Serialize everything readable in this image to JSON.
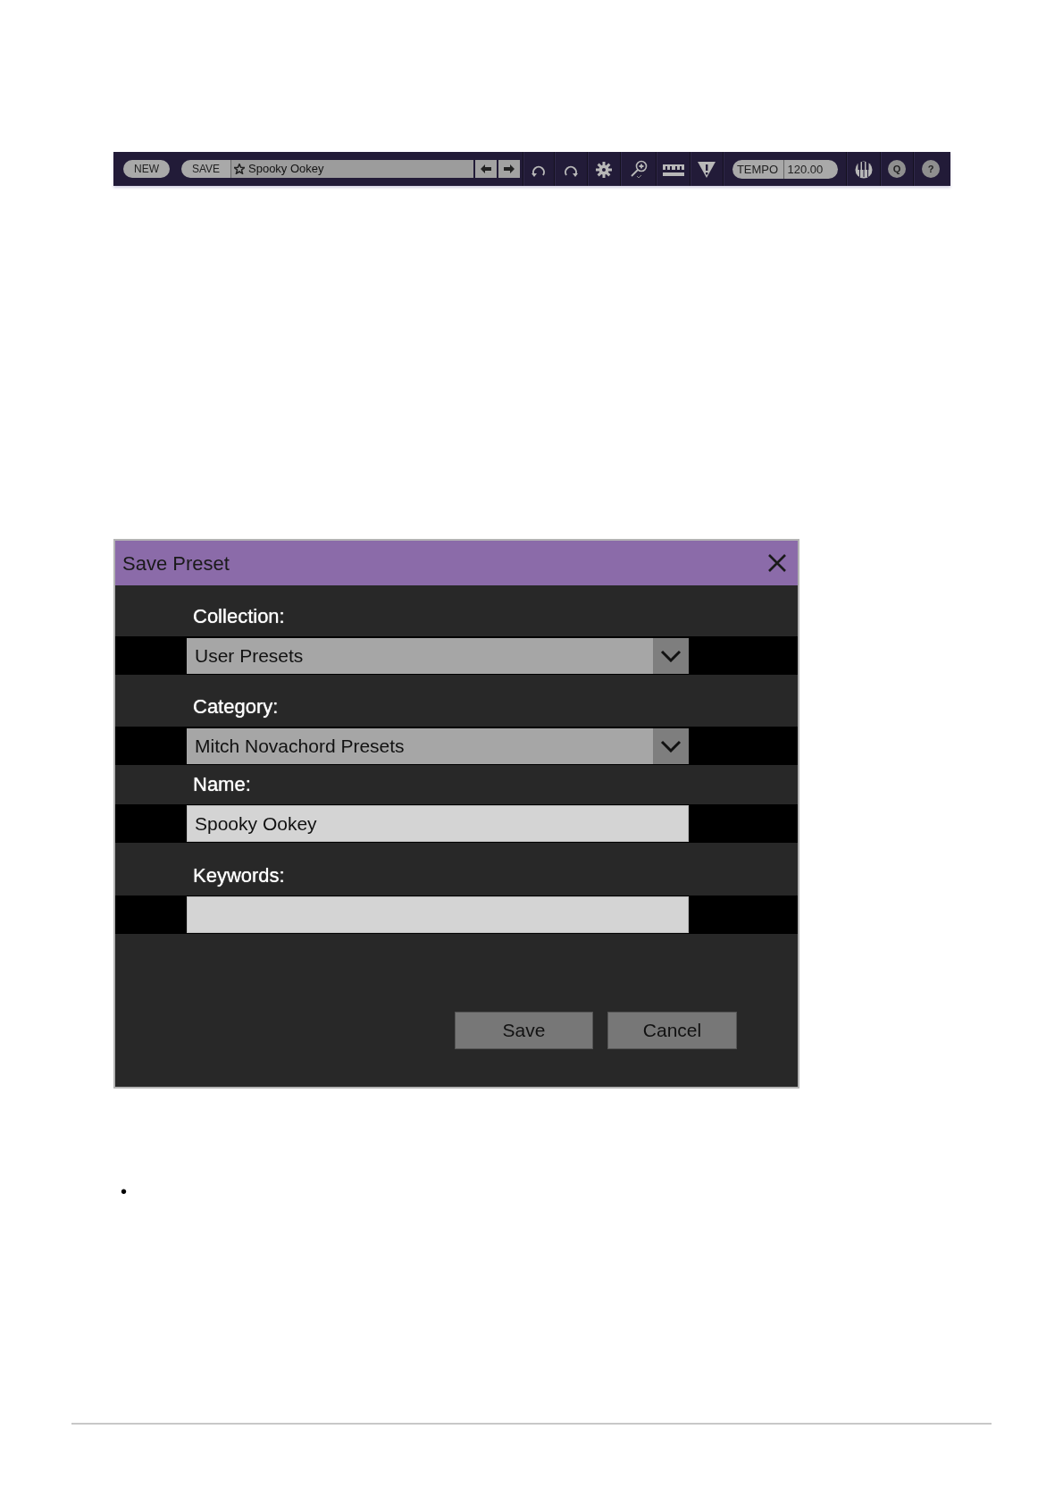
{
  "toolbar": {
    "new_button": "NEW",
    "save_button": "SAVE",
    "preset_name": "Spooky Ookey",
    "tempo_label": "TEMPO",
    "tempo_value": "120.00",
    "q_button": "Q",
    "help_button": "?"
  },
  "dialog": {
    "title": "Save Preset",
    "fields": [
      {
        "kind": "select",
        "label": "Collection:",
        "value": "User Presets"
      },
      {
        "kind": "select",
        "label": "Category:",
        "value": "Mitch Novachord Presets"
      },
      {
        "kind": "text",
        "label": "Name:",
        "value": "Spooky Ookey"
      },
      {
        "kind": "text",
        "label": "Keywords:"
      }
    ],
    "buttons": [
      "Save",
      "Cancel"
    ]
  },
  "bullet_list": [
    {
      "marker": "•"
    }
  ]
}
